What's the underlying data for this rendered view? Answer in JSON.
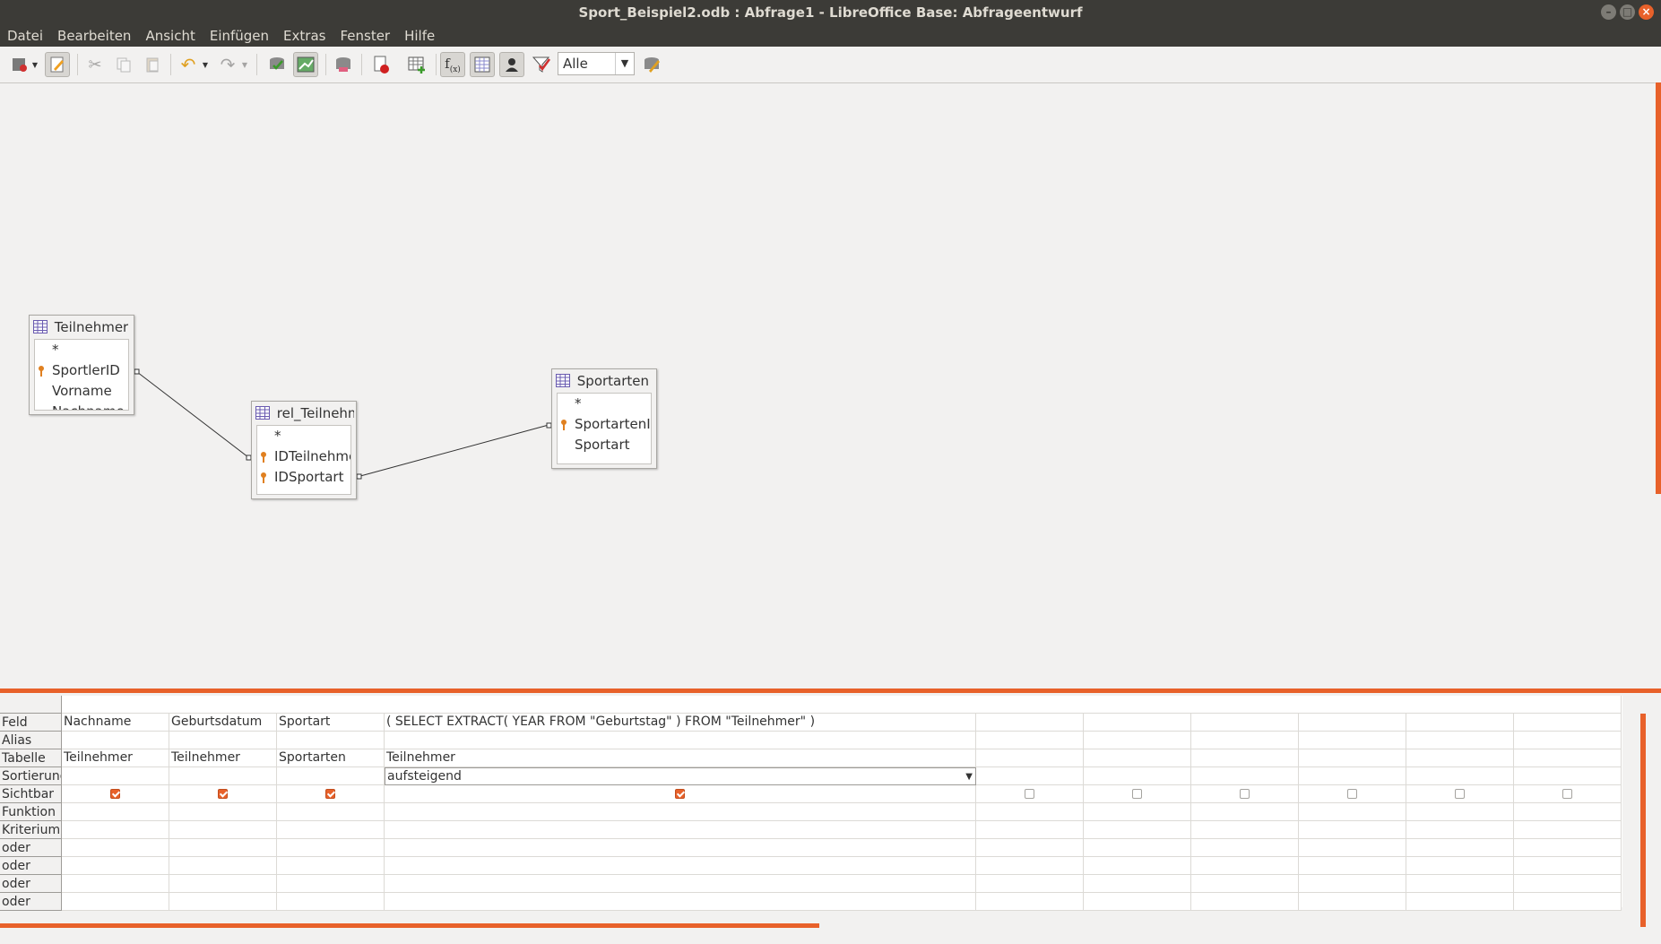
{
  "window": {
    "title": "Sport_Beispiel2.odb : Abfrage1 - LibreOffice Base: Abfrageentwurf"
  },
  "menu": [
    "Datei",
    "Bearbeiten",
    "Ansicht",
    "Einfügen",
    "Extras",
    "Fenster",
    "Hilfe"
  ],
  "toolbar": {
    "limit_value": "Alle"
  },
  "tables": [
    {
      "name": "Teilnehmer",
      "fields": [
        {
          "name": "*",
          "key": false
        },
        {
          "name": "SportlerID",
          "key": true
        },
        {
          "name": "Vorname",
          "key": false
        },
        {
          "name": "Nachname",
          "key": false
        }
      ]
    },
    {
      "name": "rel_Teilnehmer",
      "fields": [
        {
          "name": "*",
          "key": false
        },
        {
          "name": "IDTeilnehmer",
          "key": true
        },
        {
          "name": "IDSportart",
          "key": true
        }
      ]
    },
    {
      "name": "Sportarten",
      "fields": [
        {
          "name": "*",
          "key": false
        },
        {
          "name": "SportartenID",
          "key": true
        },
        {
          "name": "Sportart",
          "key": false
        }
      ]
    }
  ],
  "grid": {
    "row_labels": [
      "Feld",
      "Alias",
      "Tabelle",
      "Sortierung",
      "Sichtbar",
      "Funktion",
      "Kriterium",
      "oder",
      "oder",
      "oder",
      "oder"
    ],
    "columns": [
      {
        "feld": "Nachname",
        "tabelle": "Teilnehmer",
        "sortierung": "",
        "sichtbar": true
      },
      {
        "feld": "Geburtsdatum",
        "tabelle": "Teilnehmer",
        "sortierung": "",
        "sichtbar": true
      },
      {
        "feld": "Sportart",
        "tabelle": "Sportarten",
        "sortierung": "",
        "sichtbar": true
      },
      {
        "feld": "( SELECT EXTRACT( YEAR FROM \"Geburtstag\" ) FROM \"Teilnehmer\" )",
        "tabelle": "Teilnehmer",
        "sortierung": "aufsteigend",
        "sichtbar": true
      },
      {
        "feld": "",
        "tabelle": "",
        "sortierung": "",
        "sichtbar": false
      },
      {
        "feld": "",
        "tabelle": "",
        "sortierung": "",
        "sichtbar": false
      },
      {
        "feld": "",
        "tabelle": "",
        "sortierung": "",
        "sichtbar": false
      },
      {
        "feld": "",
        "tabelle": "",
        "sortierung": "",
        "sichtbar": false
      },
      {
        "feld": "",
        "tabelle": "",
        "sortierung": "",
        "sichtbar": false
      },
      {
        "feld": "",
        "tabelle": "",
        "sortierung": "",
        "sichtbar": false
      }
    ]
  },
  "colors": {
    "accent": "#e8612a",
    "titlebar": "#3c3b37"
  }
}
